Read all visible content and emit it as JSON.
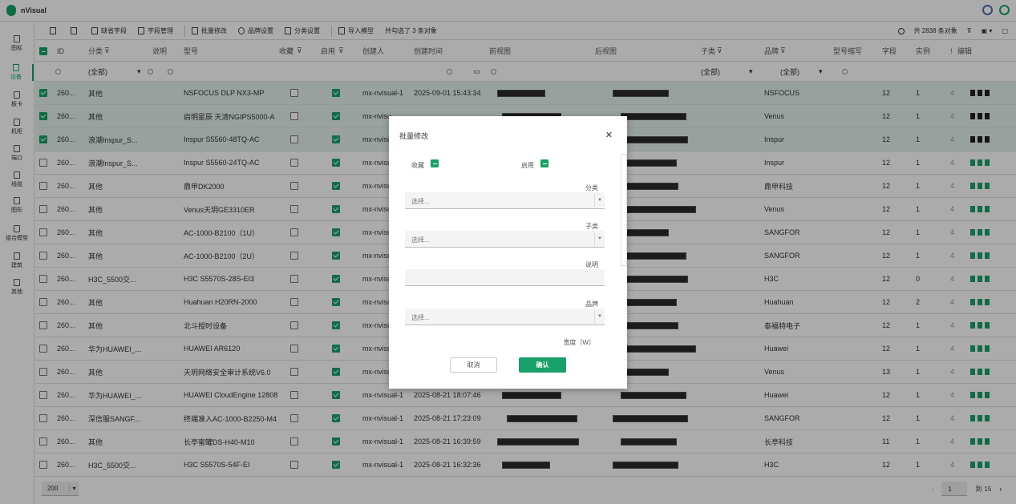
{
  "app": {
    "name": "nVisual"
  },
  "sidebar": {
    "items": [
      {
        "label": "图标"
      },
      {
        "label": "设备",
        "active": true
      },
      {
        "label": "板卡"
      },
      {
        "label": "机柜"
      },
      {
        "label": "端口"
      },
      {
        "label": "线缆"
      },
      {
        "label": "图形"
      },
      {
        "label": "组合模型"
      },
      {
        "label": "建筑"
      },
      {
        "label": "其他"
      }
    ]
  },
  "toolbar": {
    "default_fields": "缺省字段",
    "field_manage": "字段管理",
    "batch_edit": "批量修改",
    "brand_settings": "品牌设置",
    "category_settings": "分类设置",
    "import_model": "导入模型",
    "selected_text": "共勾选了 3 条对象",
    "total_text": "共 2838 条对象"
  },
  "columns": {
    "id": "ID",
    "category": "分类",
    "desc": "说明",
    "model": "型号",
    "favorite": "收藏",
    "enabled": "启用",
    "creator": "创建人",
    "created": "创建时间",
    "front": "前视图",
    "rear": "后视图",
    "subcategory": "子类",
    "brand": "品牌",
    "model_abbr": "型号缩写",
    "fields": "字段",
    "instances": "实例",
    "warn": "!",
    "edit": "编辑"
  },
  "filters": {
    "category": "(全部)",
    "subcategory": "(全部)",
    "brand": "(全部)"
  },
  "rows": [
    {
      "id": "260...",
      "category": "其他",
      "model": "NSFOCUS DLP NX3-MP",
      "creator": "mx-nvisual-1",
      "created": "2025-09-01 15:43:34",
      "brand": "NSFOCUS",
      "fields": "12",
      "instances": "1",
      "warn": "4",
      "selected": true
    },
    {
      "id": "260...",
      "category": "其他",
      "model": "启明星辰 天清NGIPS5000-A",
      "creator": "mx-nvisu",
      "created": "",
      "brand": "Venus",
      "fields": "12",
      "instances": "1",
      "warn": "4",
      "selected": true
    },
    {
      "id": "260...",
      "category": "浪潮Inspur_S...",
      "model": "Inspur S5560-48TQ-AC",
      "creator": "mx-nvisu",
      "created": "",
      "brand": "Inspur",
      "fields": "12",
      "instances": "1",
      "warn": "4",
      "selected": true
    },
    {
      "id": "260...",
      "category": "浪潮Inspur_S...",
      "model": "Inspur S5560-24TQ-AC",
      "creator": "mx-nvisu",
      "created": "",
      "brand": "Inspur",
      "fields": "12",
      "instances": "1",
      "warn": "4"
    },
    {
      "id": "260...",
      "category": "其他",
      "model": "鼎甲DK2000",
      "creator": "mx-nvisu",
      "created": "",
      "brand": "鼎甲科技",
      "fields": "12",
      "instances": "1",
      "warn": "4"
    },
    {
      "id": "260...",
      "category": "其他",
      "model": "Venus天玥GE3310ER",
      "creator": "mx-nvisu",
      "created": "",
      "brand": "Venus",
      "fields": "12",
      "instances": "1",
      "warn": "4"
    },
    {
      "id": "260...",
      "category": "其他",
      "model": "AC-1000-B2100（1U）",
      "creator": "mx-nvisu",
      "created": "",
      "brand": "SANGFOR",
      "fields": "12",
      "instances": "1",
      "warn": "4"
    },
    {
      "id": "260...",
      "category": "其他",
      "model": "AC-1000-B2100（2U）",
      "creator": "mx-nvisu",
      "created": "",
      "brand": "SANGFOR",
      "fields": "12",
      "instances": "1",
      "warn": "4"
    },
    {
      "id": "260...",
      "category": "H3C_5500交...",
      "model": "H3C S5570S-28S-EI3",
      "creator": "mx-nvisu",
      "created": "",
      "brand": "H3C",
      "fields": "12",
      "instances": "0",
      "warn": "4"
    },
    {
      "id": "260...",
      "category": "其他",
      "model": "Huahuan H20RN-2000",
      "creator": "mx-nvisu",
      "created": "",
      "brand": "Huahuan",
      "fields": "12",
      "instances": "2",
      "warn": "4"
    },
    {
      "id": "260...",
      "category": "其他",
      "model": "北斗授时设备",
      "creator": "mx-nvisu",
      "created": "",
      "brand": "泰福特电子",
      "fields": "12",
      "instances": "1",
      "warn": "4"
    },
    {
      "id": "260...",
      "category": "华为HUAWEI_...",
      "model": "HUAWEI AR6120",
      "creator": "mx-nvisu",
      "created": "",
      "brand": "Huawei",
      "fields": "12",
      "instances": "1",
      "warn": "4"
    },
    {
      "id": "260...",
      "category": "其他",
      "model": "天玥网络安全审计系统V6.0",
      "creator": "mx-nvisu",
      "created": "",
      "brand": "Venus",
      "fields": "13",
      "instances": "1",
      "warn": "4"
    },
    {
      "id": "260...",
      "category": "华为HUAWEI_...",
      "model": "HUAWEI CloudEngine 12808",
      "creator": "mx-nvisual-1",
      "created": "2025-08-21 18:07:46",
      "brand": "Huawei",
      "fields": "12",
      "instances": "1",
      "warn": "4"
    },
    {
      "id": "260...",
      "category": "深信服SANGF...",
      "model": "终端准入AC-1000-B2250-M4",
      "creator": "mx-nvisual-1",
      "created": "2025-08-21 17:23:09",
      "brand": "SANGFOR",
      "fields": "12",
      "instances": "1",
      "warn": "4"
    },
    {
      "id": "260...",
      "category": "其他",
      "model": "长亭蜜罐DS-H40-M10",
      "creator": "mx-nvisual-1",
      "created": "2025-08-21 16:39:59",
      "brand": "长亭科技",
      "fields": "11",
      "instances": "1",
      "warn": "4"
    },
    {
      "id": "260...",
      "category": "H3C_5500交...",
      "model": "H3C S5570S-54F-EI",
      "creator": "mx-nvisual-1",
      "created": "2025-08-21 16:32:36",
      "brand": "H3C",
      "fields": "12",
      "instances": "1",
      "warn": "4"
    }
  ],
  "pagination": {
    "page_size": "200",
    "page": "1",
    "to_label": "到",
    "total_pages": "15"
  },
  "modal": {
    "title": "批量修改",
    "favorite_label": "收藏",
    "enabled_label": "启用",
    "category_label": "分类",
    "category_placeholder": "选择...",
    "subcategory_label": "子类",
    "subcategory_placeholder": "选择...",
    "desc_label": "说明",
    "brand_label": "品牌",
    "brand_placeholder": "选择...",
    "width_label": "宽度（W）",
    "cancel": "取消",
    "confirm": "确认"
  },
  "colors": {
    "accent": "#1aa06a"
  }
}
